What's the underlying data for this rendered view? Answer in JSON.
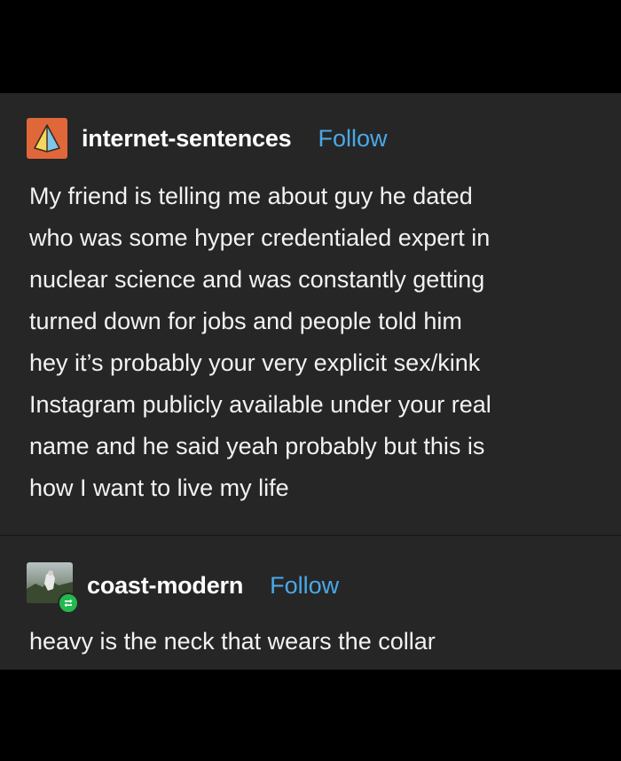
{
  "posts": [
    {
      "blog_name": "internet-sentences",
      "follow_label": "Follow",
      "avatar_icon": "pyramid-icon",
      "text": "My friend is telling me about guy he dated\nwho was some hyper credentialed expert in\nnuclear science and was constantly getting\nturned down for jobs and people told him\nhey it’s probably your very explicit sex/kink\nInstagram publicly available under your real\nname and he said yeah probably but this is\nhow I want to live my life"
    },
    {
      "blog_name": "coast-modern",
      "follow_label": "Follow",
      "avatar_icon": "reblog-icon",
      "text": "heavy is the neck that wears the collar"
    }
  ],
  "colors": {
    "panel_background": "#262626",
    "page_background": "#000000",
    "follow_link": "#4aa8e8",
    "avatar_orange": "#e0673a",
    "reblog_green": "#23b94f"
  }
}
